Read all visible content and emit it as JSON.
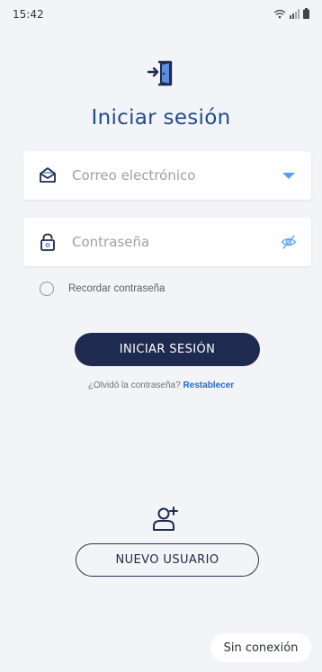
{
  "status_bar": {
    "time": "15:42",
    "icons": [
      "wifi-icon",
      "signal-icon",
      "battery-icon"
    ]
  },
  "login": {
    "icon": "login-door-icon",
    "title": "Iniciar sesión",
    "email_placeholder": "Correo electrónico",
    "email_icon": "envelope-icon",
    "email_dropdown_icon": "dropdown-caret-icon",
    "password_placeholder": "Contraseña",
    "password_icon": "lock-icon",
    "password_toggle_icon": "eye-off-icon",
    "remember_label": "Recordar contraseña",
    "remember_checked": false,
    "submit_label": "INICIAR SESIÓN",
    "forgot_text": "¿Olvidó la contraseña?",
    "forgot_link": "Restablecer"
  },
  "register": {
    "icon": "add-user-icon",
    "button_label": "NUEVO USUARIO"
  },
  "footer": {
    "offline_label": "Sin conexión"
  },
  "colors": {
    "background": "#f3f4f7",
    "title": "#1e4b8f",
    "primary_button": "#1e2a4f",
    "link": "#1e6dd0",
    "accent_icon": "#5b8de0"
  }
}
